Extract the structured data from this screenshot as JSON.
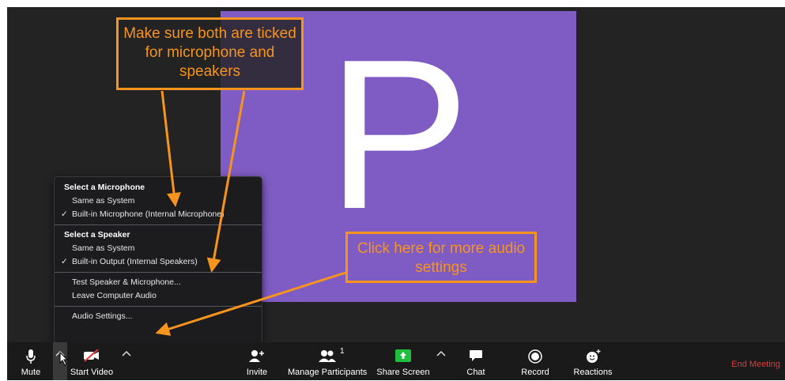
{
  "video": {
    "avatar_letter": "P",
    "tile_color": "#7f5cc3"
  },
  "audio_menu": {
    "mic_section_title": "Select a Microphone",
    "mic_options": [
      {
        "label": "Same as System",
        "checked": false
      },
      {
        "label": "Built-in Microphone (Internal Microphone)",
        "checked": true
      }
    ],
    "speaker_section_title": "Select a Speaker",
    "speaker_options": [
      {
        "label": "Same as System",
        "checked": false
      },
      {
        "label": "Built-in Output (Internal Speakers)",
        "checked": true
      }
    ],
    "actions": {
      "test_speaker": "Test Speaker & Microphone...",
      "leave_audio": "Leave Computer Audio",
      "audio_settings": "Audio Settings..."
    },
    "check_glyph": "✓"
  },
  "annotations": {
    "tick_note": "Make sure both are ticked for microphone and speakers",
    "settings_note": "Click here for more audio settings",
    "accent_color": "#f7941d"
  },
  "toolbar": {
    "mute": "Mute",
    "start_video": "Start Video",
    "invite": "Invite",
    "manage_participants": "Manage Participants",
    "participant_count": "1",
    "share_screen": "Share Screen",
    "chat": "Chat",
    "record": "Record",
    "reactions": "Reactions",
    "end_meeting": "End Meeting",
    "end_color": "#e03b3b",
    "share_color": "#1fbe3f"
  }
}
